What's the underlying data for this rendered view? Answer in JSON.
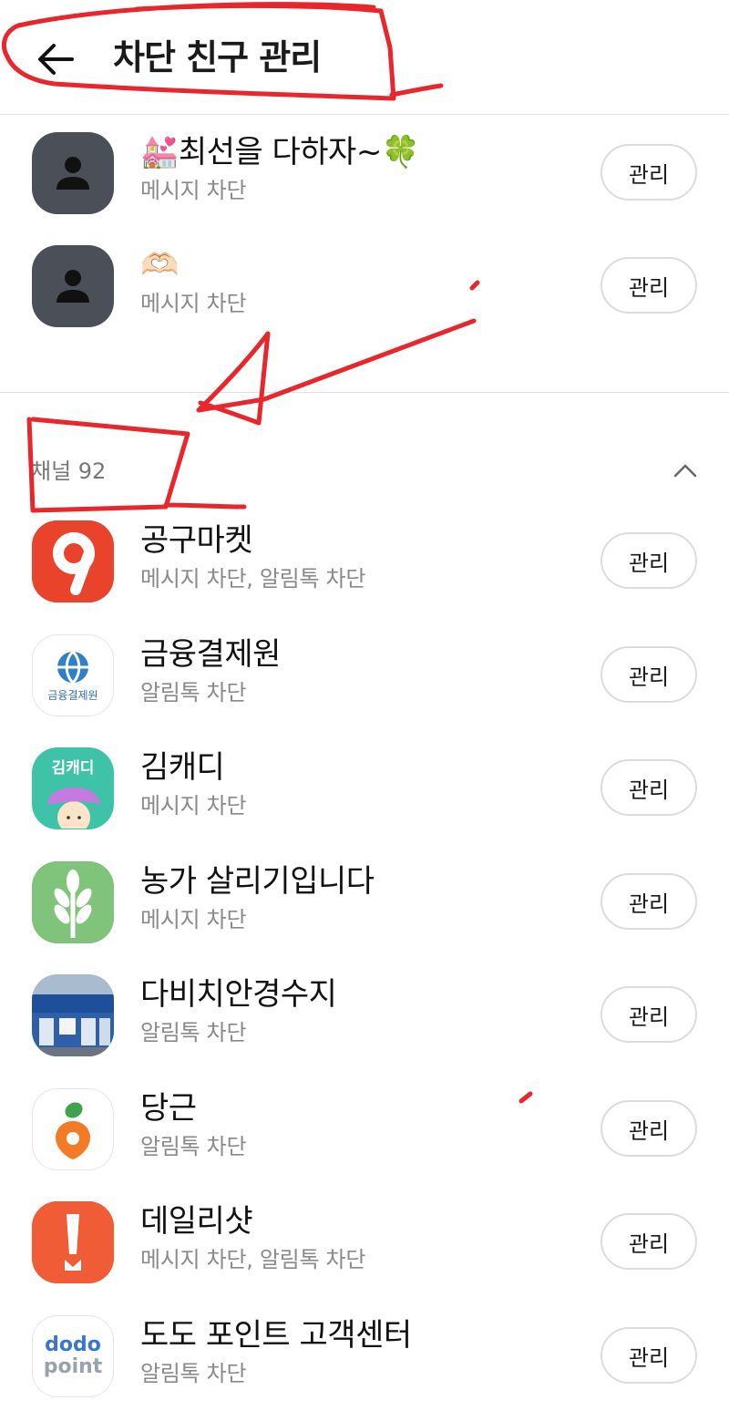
{
  "header": {
    "title": "차단 친구 관리",
    "back_icon": "arrow-left-icon"
  },
  "friends": [
    {
      "name": "💒최선을 다하자~🍀",
      "status": "메시지 차단",
      "button": "관리",
      "avatar_icon": "person-icon"
    },
    {
      "name": "🫶🏻",
      "status": "메시지 차단",
      "button": "관리",
      "avatar_icon": "person-icon"
    }
  ],
  "channel_section": {
    "label": "채널 92",
    "toggle_icon": "chevron-up-icon"
  },
  "channels": [
    {
      "name": "공구마켓",
      "status": "메시지 차단, 알림톡 차단",
      "button": "관리",
      "logo": "gonggu-market-logo"
    },
    {
      "name": "금융결제원",
      "status": "알림톡 차단",
      "button": "관리",
      "logo": "kftc-logo",
      "logo_text": "금융결제원"
    },
    {
      "name": "김캐디",
      "status": "메시지 차단",
      "button": "관리",
      "logo": "kimcaddie-logo",
      "logo_text": "김캐디"
    },
    {
      "name": "농가 살리기입니다",
      "status": "메시지 차단",
      "button": "관리",
      "logo": "wheat-logo"
    },
    {
      "name": "다비치안경수지",
      "status": "알림톡 차단",
      "button": "관리",
      "logo": "store-photo"
    },
    {
      "name": "당근",
      "status": "알림톡 차단",
      "button": "관리",
      "logo": "carrot-logo"
    },
    {
      "name": "데일리샷",
      "status": "메시지 차단, 알림톡 차단",
      "button": "관리",
      "logo": "dailyshot-logo"
    },
    {
      "name": "도도 포인트 고객센터",
      "status": "알림톡 차단",
      "button": "관리",
      "logo": "dodo-point-logo",
      "logo_text": [
        "dodo",
        "point"
      ]
    }
  ],
  "colors": {
    "annotation_red": "#e8262b",
    "divider": "#e3e3e3",
    "status_gray": "#8a8a8a"
  }
}
